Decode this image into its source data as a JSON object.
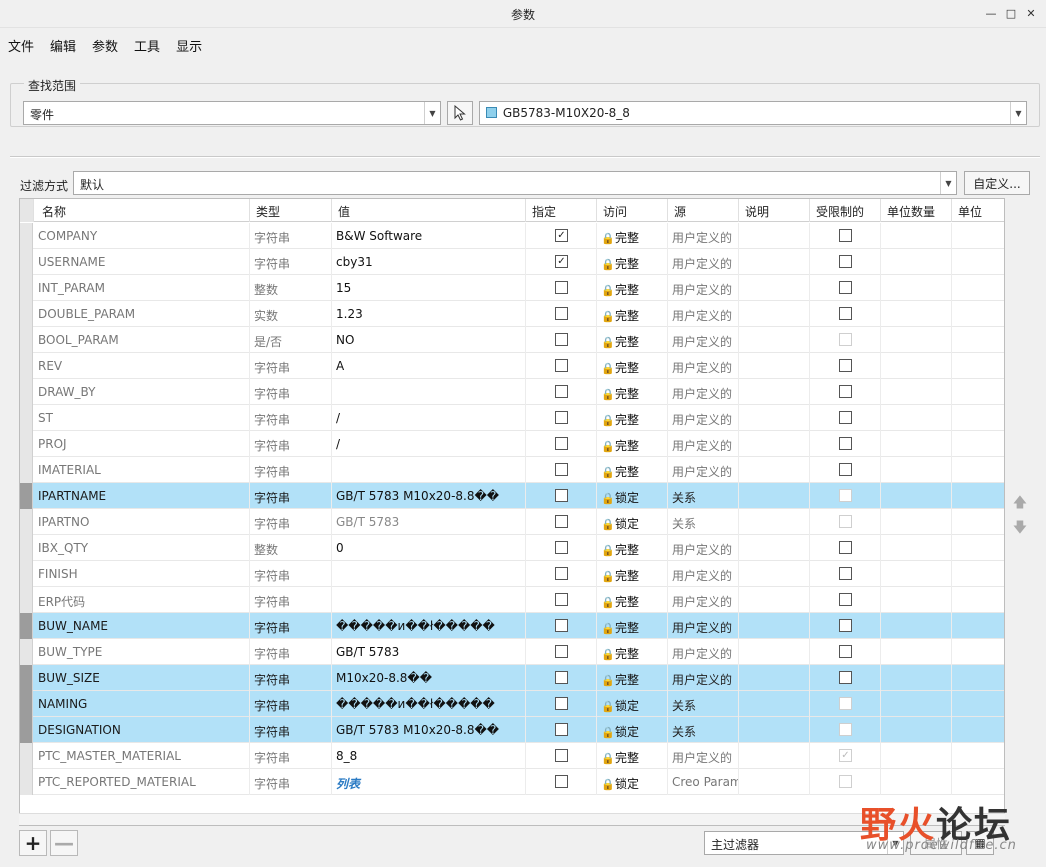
{
  "window": {
    "title": "参数"
  },
  "menu": [
    "文件",
    "编辑",
    "参数",
    "工具",
    "显示"
  ],
  "search_scope": {
    "label": "查找范围",
    "type_value": "零件",
    "model_value": "GB5783-M10X20-8_8"
  },
  "filter": {
    "label": "过滤方式",
    "value": "默认",
    "custom_button": "自定义..."
  },
  "table": {
    "columns": [
      "名称",
      "类型",
      "值",
      "指定",
      "访问",
      "源",
      "说明",
      "受限制的",
      "单位数量",
      "单位"
    ],
    "rows": [
      {
        "name": "COMPANY",
        "type": "字符串",
        "value": "B&W Software",
        "assigned": true,
        "access": "完整",
        "source": "用户定义的",
        "restricted": "off"
      },
      {
        "name": "USERNAME",
        "type": "字符串",
        "value": "cby31",
        "assigned": true,
        "access": "完整",
        "source": "用户定义的",
        "restricted": "off"
      },
      {
        "name": "INT_PARAM",
        "type": "整数",
        "value": "15",
        "assigned": false,
        "access": "完整",
        "source": "用户定义的",
        "restricted": "off"
      },
      {
        "name": "DOUBLE_PARAM",
        "type": "实数",
        "value": "1.23",
        "assigned": false,
        "access": "完整",
        "source": "用户定义的",
        "restricted": "off"
      },
      {
        "name": "BOOL_PARAM",
        "type": "是/否",
        "value": "NO",
        "assigned": false,
        "access": "完整",
        "source": "用户定义的",
        "restricted": "disabled"
      },
      {
        "name": "REV",
        "type": "字符串",
        "value": "A",
        "assigned": false,
        "access": "完整",
        "source": "用户定义的",
        "restricted": "off"
      },
      {
        "name": "DRAW_BY",
        "type": "字符串",
        "value": "",
        "assigned": false,
        "access": "完整",
        "source": "用户定义的",
        "restricted": "off"
      },
      {
        "name": "ST",
        "type": "字符串",
        "value": "/",
        "assigned": false,
        "access": "完整",
        "source": "用户定义的",
        "restricted": "off"
      },
      {
        "name": "PROJ",
        "type": "字符串",
        "value": "/",
        "assigned": false,
        "access": "完整",
        "source": "用户定义的",
        "restricted": "off"
      },
      {
        "name": "IMATERIAL",
        "type": "字符串",
        "value": "",
        "assigned": false,
        "access": "完整",
        "source": "用户定义的",
        "restricted": "off"
      },
      {
        "name": "IPARTNAME",
        "type": "字符串",
        "value": "GB/T 5783 M10x20-8.8��",
        "assigned": false,
        "access": "锁定",
        "source": "关系",
        "restricted": "disabled",
        "selected": true
      },
      {
        "name": "IPARTNO",
        "type": "字符串",
        "value": "GB/T 5783",
        "assigned": false,
        "access": "锁定",
        "source": "关系",
        "restricted": "disabled",
        "dim": true
      },
      {
        "name": "IBX_QTY",
        "type": "整数",
        "value": "0",
        "assigned": false,
        "access": "完整",
        "source": "用户定义的",
        "restricted": "off"
      },
      {
        "name": "FINISH",
        "type": "字符串",
        "value": "",
        "assigned": false,
        "access": "完整",
        "source": "用户定义的",
        "restricted": "off"
      },
      {
        "name": "ERP代码",
        "type": "字符串",
        "value": "",
        "assigned": false,
        "access": "完整",
        "source": "用户定义的",
        "restricted": "off"
      },
      {
        "name": "BUW_NAME",
        "type": "字符串",
        "value": "�����и��ł�����",
        "assigned": false,
        "access": "完整",
        "source": "用户定义的",
        "restricted": "off",
        "selected": true
      },
      {
        "name": "BUW_TYPE",
        "type": "字符串",
        "value": "GB/T 5783",
        "assigned": false,
        "access": "完整",
        "source": "用户定义的",
        "restricted": "off"
      },
      {
        "name": "BUW_SIZE",
        "type": "字符串",
        "value": "M10x20-8.8��",
        "assigned": false,
        "access": "完整",
        "source": "用户定义的",
        "restricted": "off",
        "selected": true
      },
      {
        "name": "NAMING",
        "type": "字符串",
        "value": "�����и��ł�����",
        "assigned": false,
        "access": "锁定",
        "source": "关系",
        "restricted": "disabled",
        "selected": true
      },
      {
        "name": "DESIGNATION",
        "type": "字符串",
        "value": "GB/T 5783 M10x20-8.8��",
        "assigned": false,
        "access": "锁定",
        "source": "关系",
        "restricted": "disabled",
        "selected": true
      },
      {
        "name": "PTC_MASTER_MATERIAL",
        "type": "字符串",
        "value": "8_8",
        "assigned": false,
        "access": "完整",
        "source": "用户定义的",
        "restricted": "disabled-checked"
      },
      {
        "name": "PTC_REPORTED_MATERIAL",
        "type": "字符串",
        "value": "列表",
        "assigned": false,
        "access": "锁定",
        "source": "Creo Param",
        "restricted": "disabled",
        "link": true
      }
    ]
  },
  "bottom": {
    "filter_select": "主过滤器",
    "properties_button": "属性"
  },
  "watermark": {
    "cn_1": "野火",
    "cn_2": "论坛",
    "url": "www.proewildfire.cn"
  },
  "colors": {
    "selected_row": "#b2e1f8",
    "watermark_red": "#e8502a"
  }
}
